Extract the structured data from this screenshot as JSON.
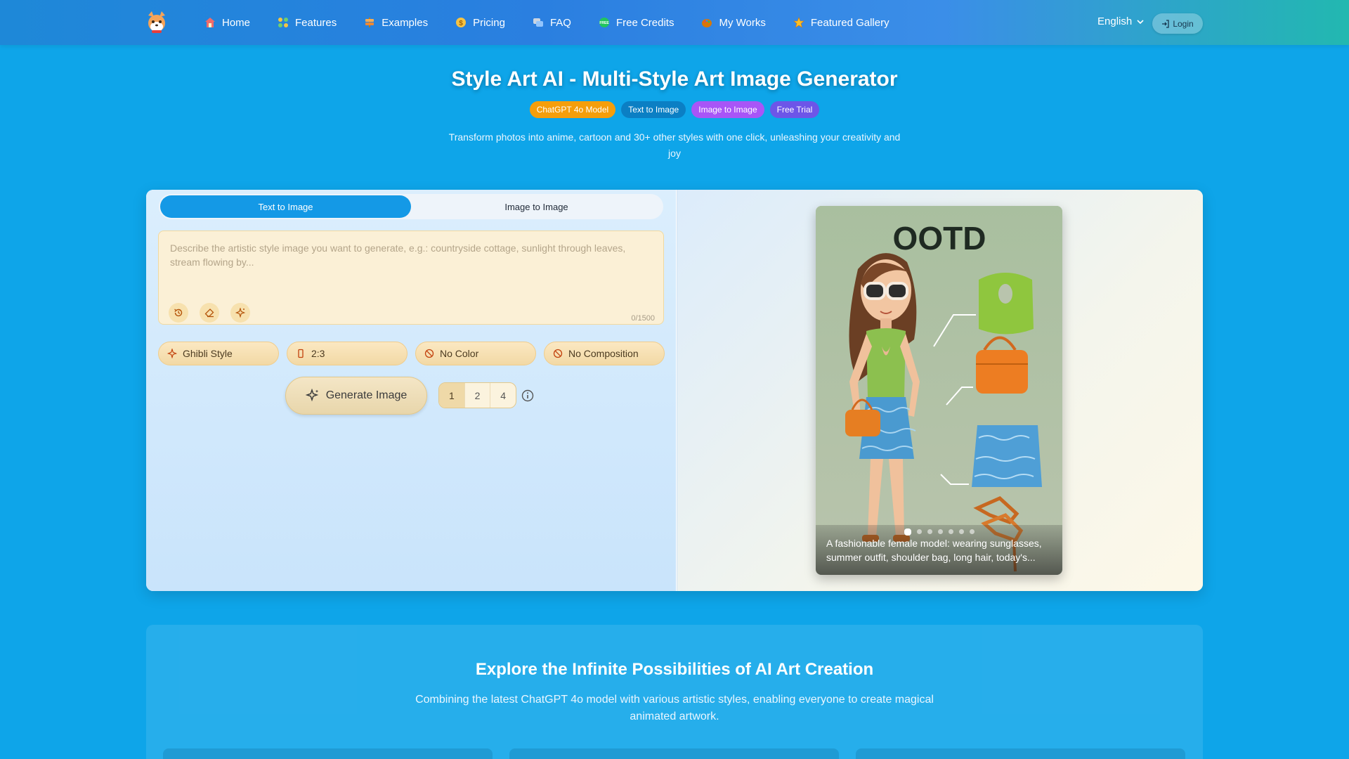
{
  "nav": {
    "items": [
      {
        "label": "Home",
        "icon": "home-icon"
      },
      {
        "label": "Features",
        "icon": "grid-icon"
      },
      {
        "label": "Examples",
        "icon": "signpost-icon"
      },
      {
        "label": "Pricing",
        "icon": "coin-icon"
      },
      {
        "label": "FAQ",
        "icon": "chat-icon"
      },
      {
        "label": "Free Credits",
        "icon": "free-icon"
      },
      {
        "label": "My Works",
        "icon": "palette-icon"
      },
      {
        "label": "Featured Gallery",
        "icon": "star-icon"
      }
    ],
    "language": "English",
    "login": "Login"
  },
  "hero": {
    "title": "Style Art AI - Multi-Style Art Image Generator",
    "tags": [
      {
        "label": "ChatGPT 4o Model",
        "color": "#f59e0b"
      },
      {
        "label": "Text to Image",
        "color": "#0b7fc4"
      },
      {
        "label": "Image to Image",
        "color": "#a855f7"
      },
      {
        "label": "Free Trial",
        "color": "#6d55e8"
      }
    ],
    "subtitle": "Transform photos into anime, cartoon and 30+ other styles with one click, unleashing your creativity and joy"
  },
  "generator": {
    "tabs": [
      "Text to Image",
      "Image to Image"
    ],
    "active_tab": 0,
    "prompt_placeholder": "Describe the artistic style image you want to generate, e.g.: countryside cottage, sunlight through leaves, stream flowing by...",
    "prompt_value": "",
    "counter": "0/1500",
    "options": {
      "style": "Ghibli Style",
      "ratio": "2:3",
      "color": "No Color",
      "composition": "No Composition"
    },
    "generate_label": "Generate Image",
    "counts": [
      "1",
      "2",
      "4"
    ],
    "active_count": 0
  },
  "preview": {
    "heading": "OOTD",
    "caption": "A fashionable female model: wearing sunglasses, summer outfit, shoulder bag, long hair, today's...",
    "slides": 7,
    "active_slide": 0
  },
  "explore": {
    "title": "Explore the Infinite Possibilities of AI Art Creation",
    "subtitle": "Combining the latest ChatGPT 4o model with various artistic styles, enabling everyone to create magical animated artwork."
  }
}
